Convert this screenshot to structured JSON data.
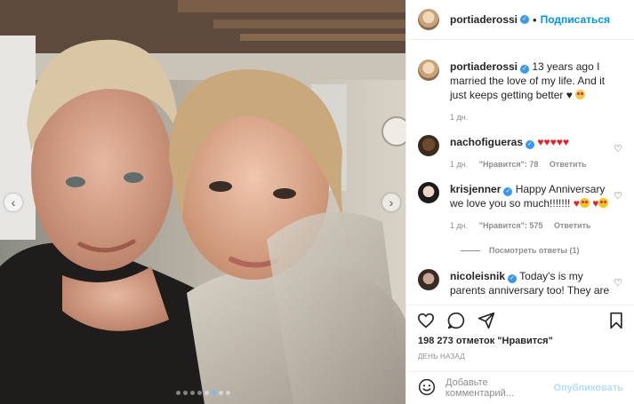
{
  "post": {
    "author": "portiaderossi",
    "follow_label": "Подписаться",
    "separator": "•",
    "carousel": {
      "slides": 8,
      "active_index": 5
    }
  },
  "caption": {
    "username": "portiaderossi",
    "text": "13 years ago I married the love of my life. And it just keeps getting better ♥",
    "time": "1 дн."
  },
  "comments": [
    {
      "username": "nachofigueras",
      "text": "",
      "time": "1 дн.",
      "likes": "\"Нравится\": 78",
      "reply": "Ответить"
    },
    {
      "username": "krisjenner",
      "text": "Happy Anniversary we love you so much!!!!!!!",
      "time": "1 дн.",
      "likes": "\"Нравится\": 575",
      "reply": "Ответить"
    },
    {
      "username": "nicoleisnik",
      "text": "Today's is my parents anniversary too! They are"
    }
  ],
  "view_replies": "Посмотреть ответы (1)",
  "likes_text": "198 273 отметок \"Нравится\"",
  "time_ago": "ДЕНЬ НАЗАД",
  "add_comment": {
    "placeholder": "Добавьте комментарий...",
    "publish": "Опубликовать"
  },
  "icons": [
    "heart-icon",
    "comment-icon",
    "share-icon",
    "bookmark-icon",
    "smile-icon",
    "verified-badge-icon"
  ],
  "colors": {
    "accent": "#0095f6",
    "verified": "#3897f0",
    "muted": "#8e8e8e",
    "border": "#efefef",
    "publish_disabled": "#b2dffc"
  }
}
